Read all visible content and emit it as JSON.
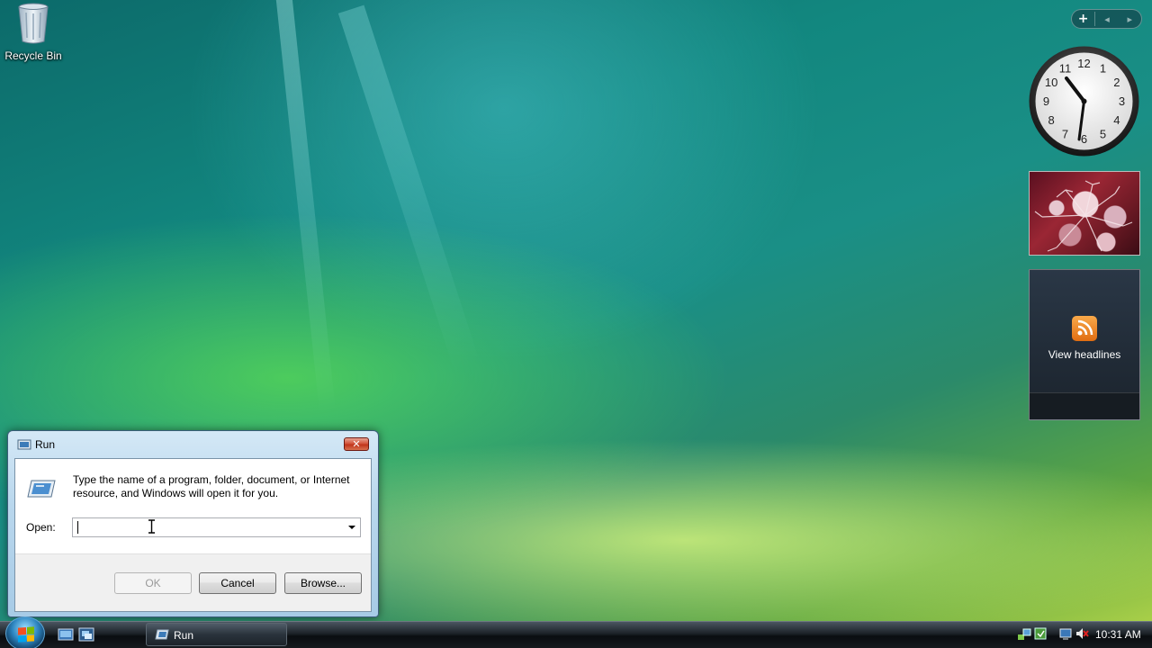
{
  "desktop": {
    "icons": [
      {
        "label": "Recycle Bin",
        "icon": "recycle-bin-icon"
      }
    ]
  },
  "sidebar": {
    "controls": {
      "add": "+",
      "prev": "◂",
      "next": "▸"
    },
    "clock": {
      "time": "10:31",
      "numerals": [
        "12",
        "1",
        "2",
        "3",
        "4",
        "5",
        "6",
        "7",
        "8",
        "9",
        "10",
        "11"
      ]
    },
    "slideshow": {
      "subject": "frost-covered red leaves"
    },
    "feeds": {
      "label": "View headlines",
      "icon": "rss-icon"
    }
  },
  "run_dialog": {
    "title": "Run",
    "close_label": "✕",
    "description": "Type the name of a program, folder, document, or Internet resource, and Windows will open it for you.",
    "open_label": "Open:",
    "open_value": "",
    "ok_label": "OK",
    "cancel_label": "Cancel",
    "browse_label": "Browse...",
    "ok_enabled": false
  },
  "taskbar": {
    "start_icon": "windows-logo-icon",
    "quick_launch": [
      "show-desktop-icon",
      "switch-windows-icon"
    ],
    "tasks": [
      {
        "label": "Run",
        "icon": "run-icon"
      }
    ],
    "tray_icons": [
      "network-icon",
      "windows-defender-icon",
      "power-icon",
      "volume-muted-icon"
    ],
    "clock": "10:31 AM"
  },
  "colors": {
    "accent": "#2e86c1",
    "close_red": "#c1351b",
    "taskbar": "#15191d"
  }
}
